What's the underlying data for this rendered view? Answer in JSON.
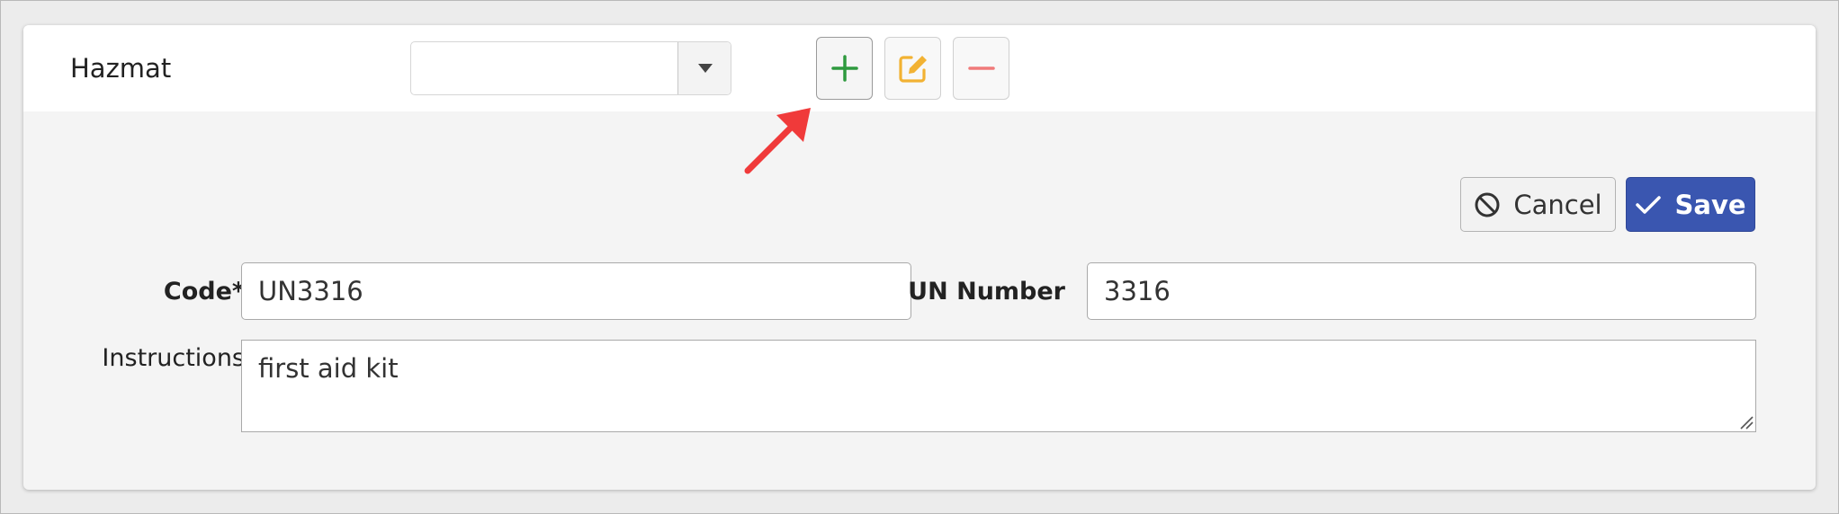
{
  "header": {
    "label": "Hazmat",
    "select": {
      "value": ""
    }
  },
  "toolbar": {
    "add_icon": "plus-icon",
    "edit_icon": "edit-icon",
    "remove_icon": "minus-icon"
  },
  "actions": {
    "cancel_label": "Cancel",
    "save_label": "Save"
  },
  "form": {
    "code_label": "Code*",
    "code_value": "UN3316",
    "un_number_label": "UN Number",
    "un_number_value": "3316",
    "instructions_label": "Instructions",
    "instructions_value": "first aid kit"
  },
  "colors": {
    "save_button": "#3a56b0",
    "add_icon": "#2e9a3e",
    "edit_icon": "#f2b233",
    "remove_icon": "#f07a7a",
    "annotation_arrow": "#f03a3a"
  }
}
